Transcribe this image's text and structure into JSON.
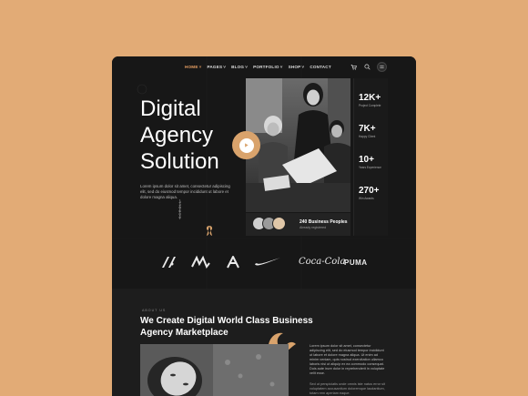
{
  "nav": {
    "items": [
      {
        "label": "HOME",
        "chevron": true,
        "active": true
      },
      {
        "label": "PAGES",
        "chevron": true
      },
      {
        "label": "BLOG",
        "chevron": true
      },
      {
        "label": "PORTFOLIO",
        "chevron": true
      },
      {
        "label": "SHOP",
        "chevron": true
      },
      {
        "label": "CONTACT",
        "chevron": false
      }
    ],
    "icons": [
      "cart-icon",
      "search-icon",
      "menu-icon"
    ]
  },
  "hero": {
    "title_lines": [
      "Digital",
      "Agency",
      "Solution"
    ],
    "description": "Lorem ipsum dolor sit amet, consectetur adipiscing elit, sed do eiusmod tempor incididunt ut labore et dolore magna aliqua.",
    "scroll_label": "SCROLL"
  },
  "stats": [
    {
      "value": "12K+",
      "label": "Project Complete"
    },
    {
      "value": "7K+",
      "label": "Happy Client"
    },
    {
      "value": "10+",
      "label": "Years Experience"
    },
    {
      "value": "270+",
      "label": "Win Awards"
    }
  ],
  "people_card": {
    "title": "240 Business Peoples",
    "subtitle": "Already registered"
  },
  "logos": [
    "logo-mark-1",
    "logo-mark-2",
    "logo-mark-3",
    "nike-logo",
    "Coca-Cola",
    "PUMA"
  ],
  "about": {
    "tag": "ABOUT US",
    "title": "We Create Digital World Class Business Agency Marketplace",
    "paragraph1": "Lorem ipsum dolor sit amet, consectetur adipiscing elit, sed do eiusmod tempor incididunt ut labore et dolore magna aliqua. Ut enim ad minim veniam, quis nostrud exercitation ullamco laboris nisi ut aliquip ex ea commodo consequat. Duis aute irure dolor in reprehenderit in voluptate velit esse.",
    "paragraph2": "Sed ut perspiciatis unde omnis iste natus error sit voluptatem accusantium doloremque laudantium, totam rem aperiam eaque."
  },
  "colors": {
    "page_background": "#E2AB76",
    "accent": "#E8A063",
    "frame": "#141414"
  }
}
